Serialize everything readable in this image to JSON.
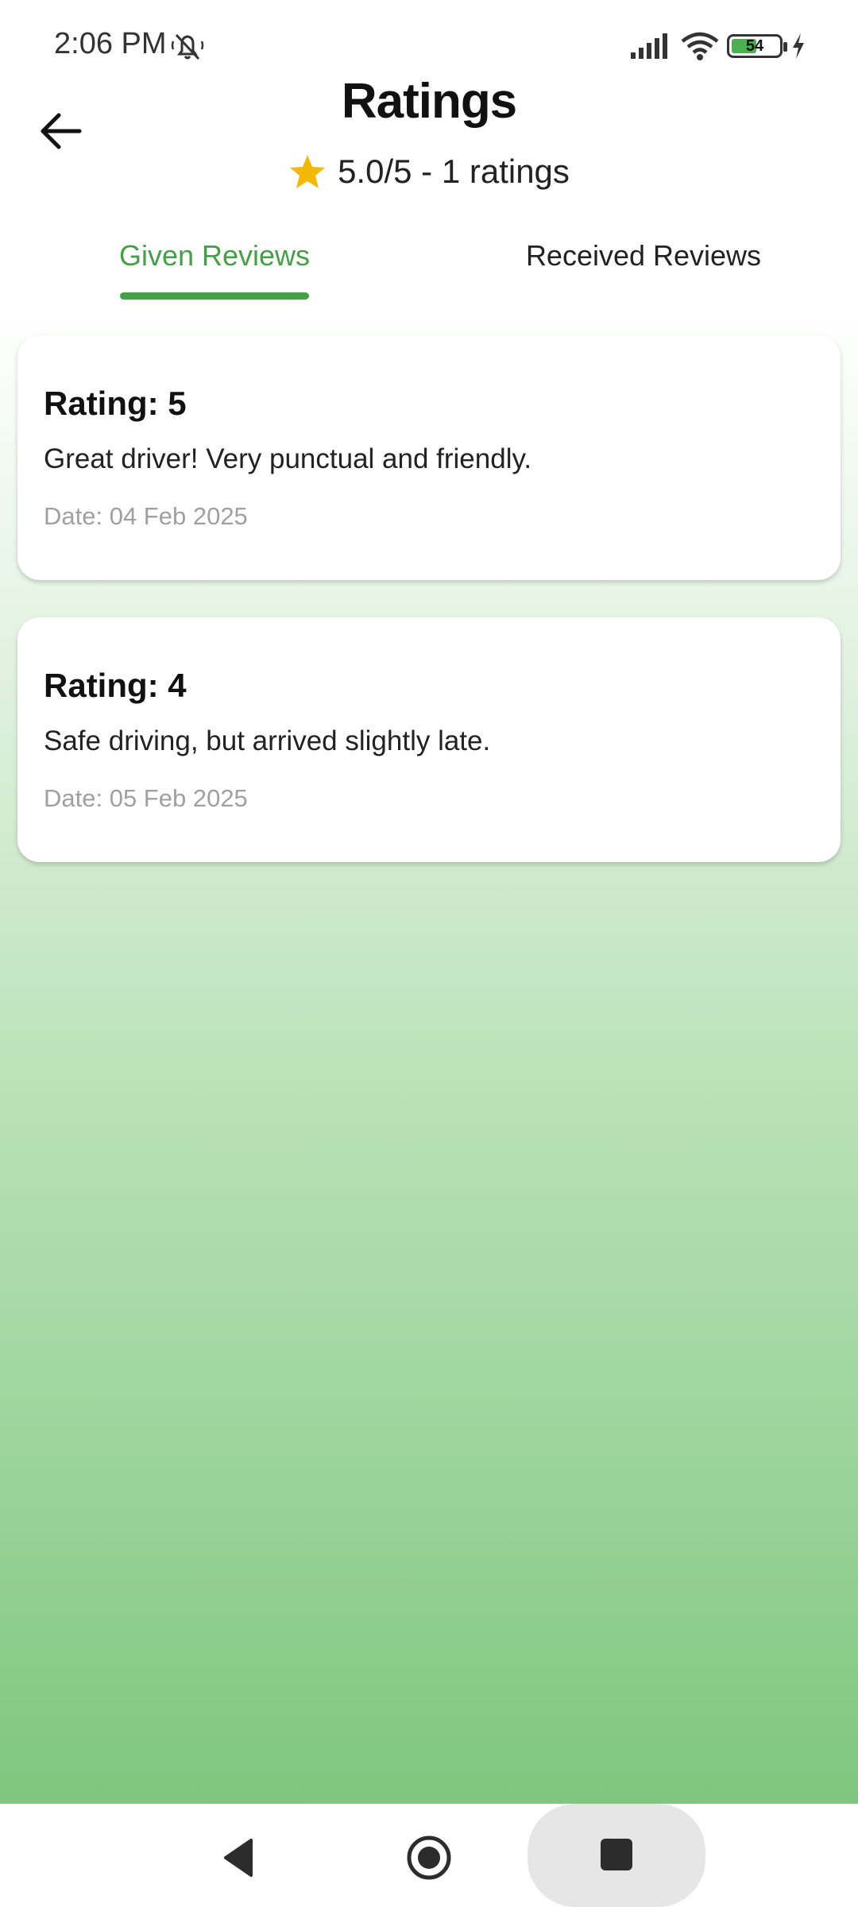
{
  "status_bar": {
    "time": "2:06 PM",
    "battery_level": "54",
    "battery_percent": 54,
    "icons": [
      "mute-bell-icon",
      "signal-icon",
      "wifi-icon",
      "battery-icon",
      "charging-bolt-icon"
    ]
  },
  "header": {
    "title": "Ratings",
    "summary": "5.0/5 - 1 ratings",
    "back_icon": "arrow-left-icon",
    "star_icon": "star-icon"
  },
  "tabs": [
    {
      "label": "Given Reviews",
      "active": true
    },
    {
      "label": "Received Reviews",
      "active": false
    }
  ],
  "reviews": [
    {
      "rating": "Rating: 5",
      "text": "Great driver! Very punctual and friendly.",
      "date": "Date: 04 Feb 2025"
    },
    {
      "rating": "Rating: 4",
      "text": "Safe driving, but arrived slightly late.",
      "date": "Date: 05 Feb 2025"
    }
  ],
  "nav": {
    "icons": [
      "nav-back-icon",
      "nav-home-icon",
      "nav-recents-icon"
    ]
  },
  "colors": {
    "accent": "#43a047",
    "star": "#f5b800",
    "gradient_bottom": "#7fc67f"
  }
}
